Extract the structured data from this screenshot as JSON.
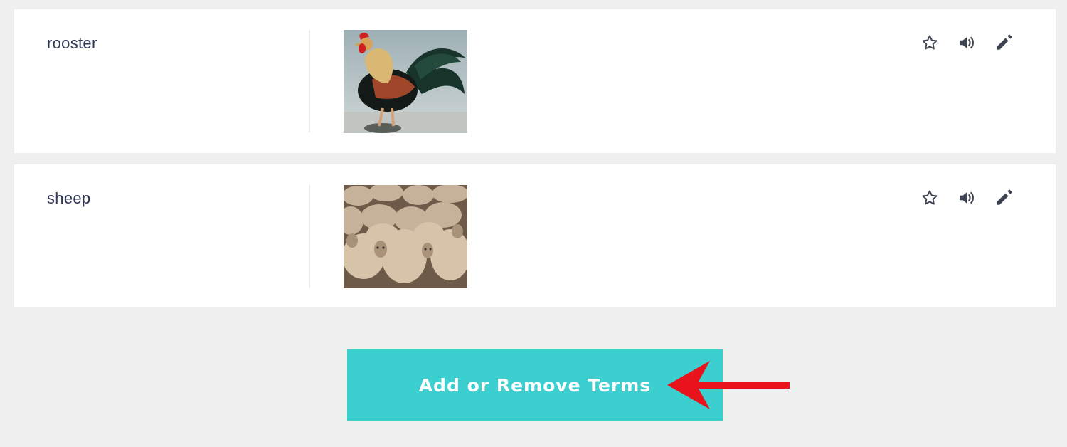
{
  "terms": [
    {
      "word": "rooster",
      "image_subject": "rooster"
    },
    {
      "word": "sheep",
      "image_subject": "flock of sheep"
    }
  ],
  "actions": {
    "star_icon": "star-icon",
    "audio_icon": "speaker-icon",
    "edit_icon": "pencil-icon"
  },
  "cta": {
    "label": "Add or Remove Terms"
  },
  "colors": {
    "background": "#efefef",
    "card": "#ffffff",
    "term_text": "#2e3856",
    "icon": "#3d4350",
    "button": "#3ccfcf",
    "annotation_arrow": "#e8131b"
  }
}
